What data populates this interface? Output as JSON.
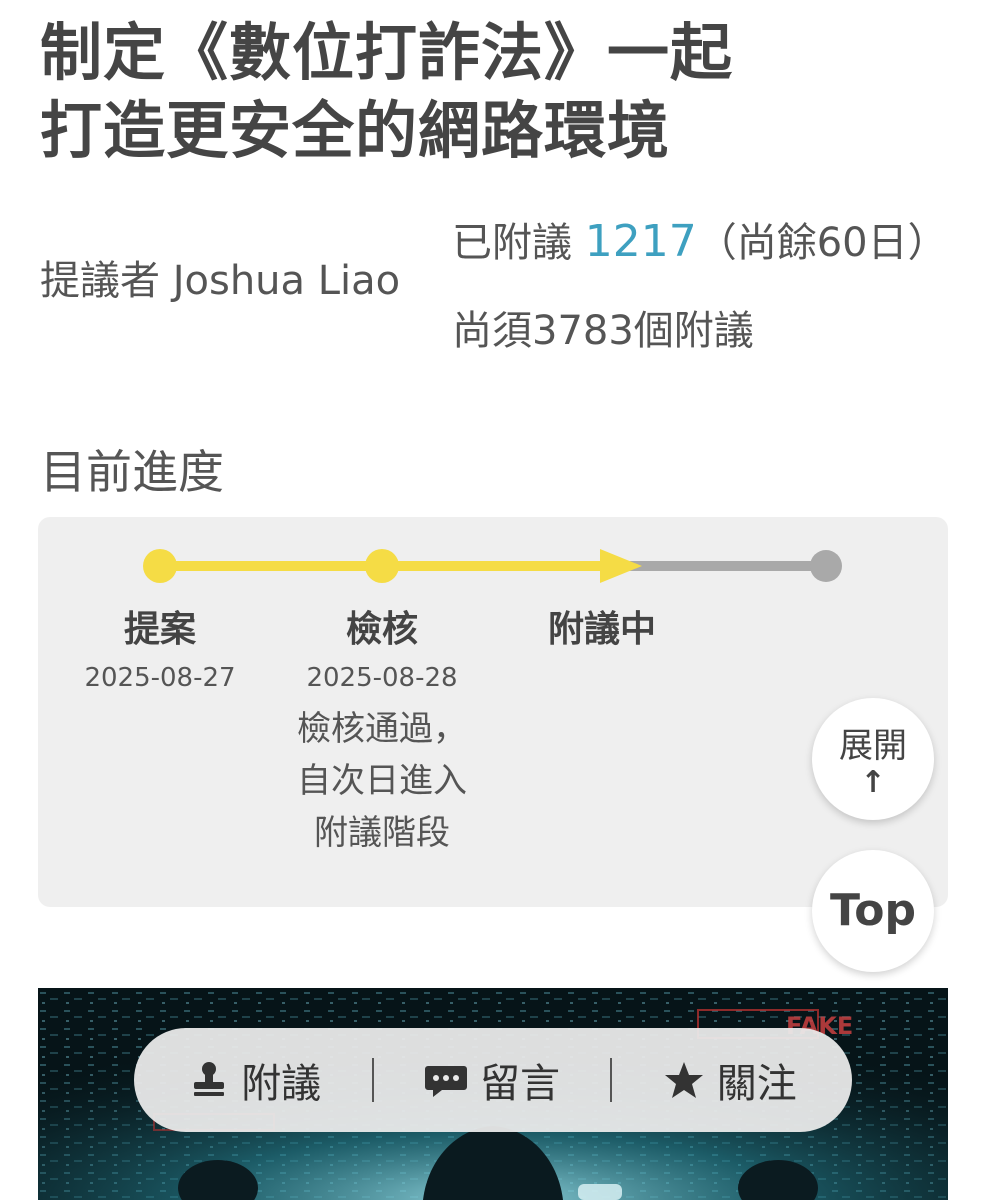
{
  "petition": {
    "title_line1": "制定《數位打詐法》一起",
    "title_line2": "打造更安全的網路環境",
    "proposer_label": "提議者",
    "proposer_name": "Joshua Liao",
    "signed_label": "已附議",
    "signed_count": "1217",
    "days_left": "（尚餘60日）",
    "needed": "尚須3783個附議"
  },
  "progress": {
    "section_title": "目前進度",
    "steps": [
      {
        "name": "提案",
        "date": "2025-08-27",
        "note": []
      },
      {
        "name": "檢核",
        "date": "2025-08-28",
        "note": [
          "檢核通過，",
          "自次日進入",
          "附議階段"
        ]
      },
      {
        "name": "附議中",
        "date": "",
        "note": []
      }
    ],
    "track_colors": {
      "done": "#f5dc45",
      "pending": "#a9a9a9"
    }
  },
  "floating": {
    "expand_label": "展開",
    "expand_arrow": "↑",
    "top_label": "Top"
  },
  "banner": {
    "image_text": "FAKE"
  },
  "actions": {
    "support_label": "附議",
    "comment_label": "留言",
    "follow_label": "關注"
  }
}
